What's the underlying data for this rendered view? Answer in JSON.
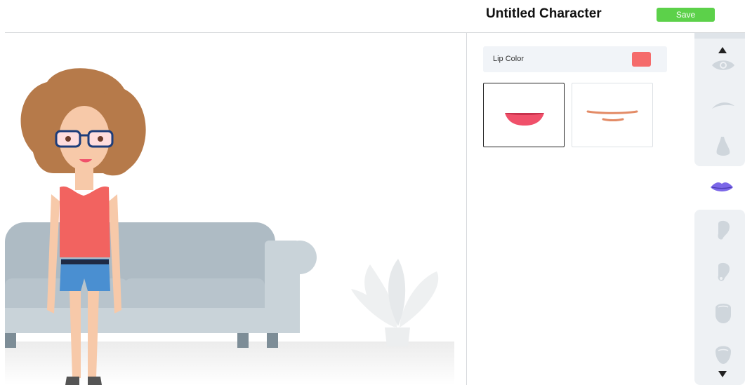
{
  "header": {
    "title": "Untitled Character",
    "save_label": "Save",
    "save_color": "#5cd14a"
  },
  "panel": {
    "lip_color_label": "Lip Color",
    "lip_color_value": "#f56b6b",
    "lip_options": [
      {
        "name": "smile-lips",
        "selected": true
      },
      {
        "name": "thin-line-lips",
        "selected": false
      }
    ]
  },
  "sidebar": {
    "items": [
      "eye-icon",
      "eyebrow-icon",
      "nose-icon",
      "lips-icon",
      "ear-icon",
      "ear-small-icon",
      "face-shape-icon",
      "face-shape-alt-icon"
    ],
    "active": "lips-icon",
    "accent": "#7b67e8"
  }
}
